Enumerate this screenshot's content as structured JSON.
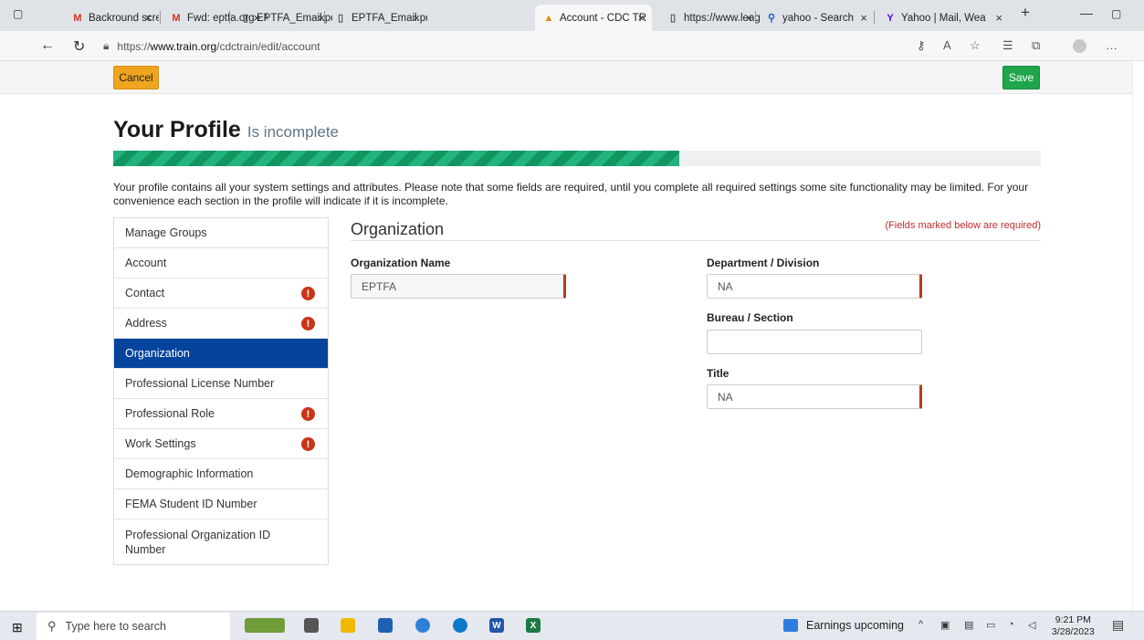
{
  "browser": {
    "tabs": [
      {
        "title": "Backround screen",
        "icon": "gmail-icon",
        "active": false
      },
      {
        "title": "Fwd: eptfa.org - M",
        "icon": "gmail-icon",
        "active": false
      },
      {
        "title": "EPTFA_Email.pdf",
        "icon": "document-icon",
        "active": false
      },
      {
        "title": "EPTFA_Email.pdf",
        "icon": "document-icon",
        "active": false
      },
      {
        "title": "Account - CDC TR",
        "icon": "train-logo-icon",
        "active": true
      },
      {
        "title": "https://www.leagu",
        "icon": "document-icon",
        "active": false
      },
      {
        "title": "yahoo - Search",
        "icon": "search-icon",
        "active": false
      },
      {
        "title": "Yahoo | Mail, Wea",
        "icon": "yahoo-icon",
        "active": false
      }
    ],
    "url_prefix": "https://",
    "url_host": "www.train.org",
    "url_path": "/cdctrain/edit/account"
  },
  "actions": {
    "cancel_label": "Cancel",
    "save_label": "Save"
  },
  "profile": {
    "title": "Your Profile",
    "status": "Is incomplete",
    "progress_percent": 61,
    "intro": "Your profile contains all your system settings and attributes. Please note that some fields are required, until you complete all required settings some site functionality may be limited. For your convenience each section in the profile will indicate if it is incomplete."
  },
  "sidebar": {
    "items": [
      {
        "label": "Manage Groups",
        "warning": false,
        "active": false
      },
      {
        "label": "Account",
        "warning": false,
        "active": false
      },
      {
        "label": "Contact",
        "warning": true,
        "active": false
      },
      {
        "label": "Address",
        "warning": true,
        "active": false
      },
      {
        "label": "Organization",
        "warning": false,
        "active": true
      },
      {
        "label": "Professional License Number",
        "warning": false,
        "active": false
      },
      {
        "label": "Professional Role",
        "warning": true,
        "active": false
      },
      {
        "label": "Work Settings",
        "warning": true,
        "active": false
      },
      {
        "label": "Demographic Information",
        "warning": false,
        "active": false
      },
      {
        "label": "FEMA Student ID Number",
        "warning": false,
        "active": false
      },
      {
        "label": "Professional Organization ID Number",
        "warning": false,
        "active": false
      }
    ],
    "warning_glyph": "!"
  },
  "section": {
    "title": "Organization",
    "required_note": "(Fields marked below are required)",
    "fields": {
      "org_name": {
        "label": "Organization Name",
        "value": "EPTFA"
      },
      "department": {
        "label": "Department / Division",
        "value": "NA"
      },
      "bureau": {
        "label": "Bureau / Section",
        "value": ""
      },
      "title": {
        "label": "Title",
        "value": "NA"
      }
    }
  },
  "taskbar": {
    "search_placeholder": "Type here to search",
    "news": "Earnings upcoming",
    "time": "9:21 PM",
    "date": "3/28/2023"
  },
  "colors": {
    "nav_active": "#04449c",
    "save": "#1fa54a",
    "cancel": "#f0a51e",
    "progress": "#22b37f",
    "required": "#c52b2b"
  }
}
